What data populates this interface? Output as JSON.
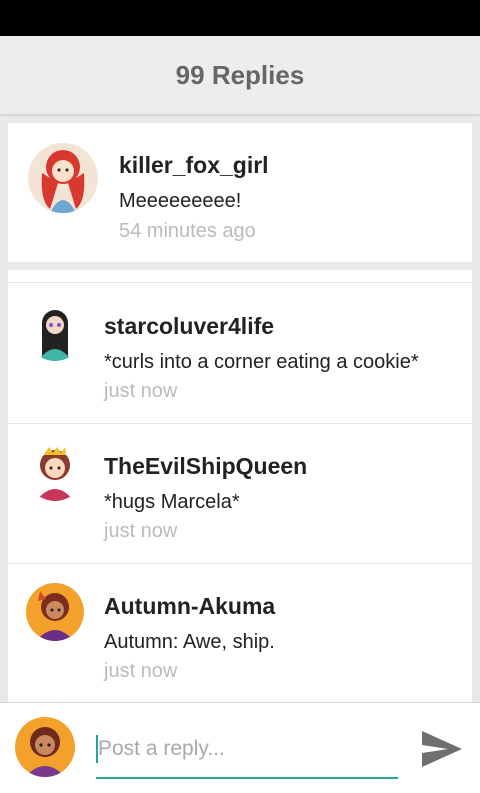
{
  "header": {
    "title": "99 Replies"
  },
  "post": {
    "username": "killer_fox_girl",
    "message": "Meeeeeeeee!",
    "time": "54 minutes ago",
    "avatar_icon": "user-avatar-icon"
  },
  "replies": [
    {
      "username": "starcoluver4life",
      "message": "*curls into a corner eating a cookie*",
      "time": "just now"
    },
    {
      "username": "TheEvilShipQueen",
      "message": "*hugs Marcela*",
      "time": "just now"
    },
    {
      "username": "Autumn-Akuma",
      "message": "Autumn: Awe, ship.",
      "time": "just now"
    }
  ],
  "composer": {
    "placeholder": "Post a reply...",
    "send_icon": "send-icon"
  },
  "colors": {
    "accent": "#26a69a",
    "header_bg": "#ededed",
    "status_bar": "#000000"
  }
}
